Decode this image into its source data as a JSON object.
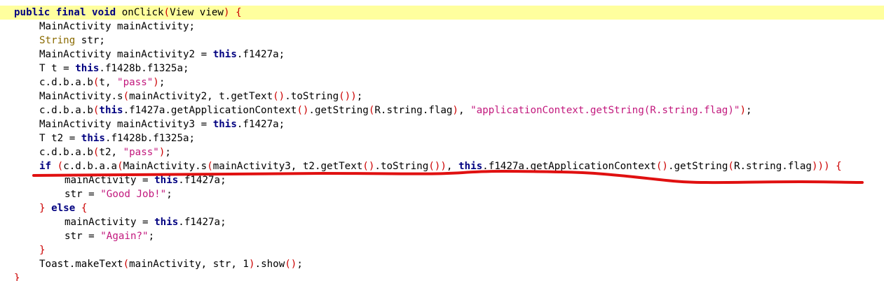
{
  "code_lines": [
    {
      "indent": 20,
      "highlighted": true,
      "tokens": [
        [
          "kw",
          "public final void "
        ],
        [
          "pl",
          "onClick"
        ],
        [
          "par",
          "("
        ],
        [
          "pl",
          "View view"
        ],
        [
          "par",
          ")"
        ],
        [
          "pl",
          " "
        ],
        [
          "par",
          "{"
        ]
      ]
    },
    {
      "indent": 56,
      "tokens": [
        [
          "pl",
          "MainActivity mainActivity;"
        ]
      ]
    },
    {
      "indent": 56,
      "tokens": [
        [
          "ty",
          "String"
        ],
        [
          "pl",
          " str;"
        ]
      ]
    },
    {
      "indent": 56,
      "tokens": [
        [
          "pl",
          "MainActivity mainActivity2 = "
        ],
        [
          "kw",
          "this"
        ],
        [
          "pl",
          ".f1427a;"
        ]
      ]
    },
    {
      "indent": 56,
      "tokens": [
        [
          "pl",
          "T t = "
        ],
        [
          "kw",
          "this"
        ],
        [
          "pl",
          ".f1428b.f1325a;"
        ]
      ]
    },
    {
      "indent": 56,
      "tokens": [
        [
          "pl",
          "c.d.b.a.b"
        ],
        [
          "par",
          "("
        ],
        [
          "pl",
          "t, "
        ],
        [
          "str",
          "\"pass\""
        ],
        [
          "par",
          ")"
        ],
        [
          "pl",
          ";"
        ]
      ]
    },
    {
      "indent": 56,
      "tokens": [
        [
          "pl",
          "MainActivity.s"
        ],
        [
          "par",
          "("
        ],
        [
          "pl",
          "mainActivity2, t.getText"
        ],
        [
          "par",
          "()"
        ],
        [
          "pl",
          ".toString"
        ],
        [
          "par",
          "())"
        ],
        [
          "pl",
          ";"
        ]
      ]
    },
    {
      "indent": 56,
      "tokens": [
        [
          "pl",
          "c.d.b.a.b"
        ],
        [
          "par",
          "("
        ],
        [
          "kw",
          "this"
        ],
        [
          "pl",
          ".f1427a.getApplicationContext"
        ],
        [
          "par",
          "()"
        ],
        [
          "pl",
          ".getString"
        ],
        [
          "par",
          "("
        ],
        [
          "pl",
          "R.string.flag"
        ],
        [
          "par",
          ")"
        ],
        [
          "pl",
          ", "
        ],
        [
          "str",
          "\"applicationContext.getString(R.string.flag)\""
        ],
        [
          "par",
          ")"
        ],
        [
          "pl",
          ";"
        ]
      ]
    },
    {
      "indent": 56,
      "tokens": [
        [
          "pl",
          "MainActivity mainActivity3 = "
        ],
        [
          "kw",
          "this"
        ],
        [
          "pl",
          ".f1427a;"
        ]
      ]
    },
    {
      "indent": 56,
      "tokens": [
        [
          "pl",
          "T t2 = "
        ],
        [
          "kw",
          "this"
        ],
        [
          "pl",
          ".f1428b.f1325a;"
        ]
      ]
    },
    {
      "indent": 56,
      "tokens": [
        [
          "pl",
          "c.d.b.a.b"
        ],
        [
          "par",
          "("
        ],
        [
          "pl",
          "t2, "
        ],
        [
          "str",
          "\"pass\""
        ],
        [
          "par",
          ")"
        ],
        [
          "pl",
          ";"
        ]
      ]
    },
    {
      "indent": 56,
      "tokens": [
        [
          "kw",
          "if"
        ],
        [
          "pl",
          " "
        ],
        [
          "par",
          "("
        ],
        [
          "pl",
          "c.d.b.a.a"
        ],
        [
          "par",
          "("
        ],
        [
          "pl",
          "MainActivity.s"
        ],
        [
          "par",
          "("
        ],
        [
          "pl",
          "mainActivity3, t2.getText"
        ],
        [
          "par",
          "()"
        ],
        [
          "pl",
          ".toString"
        ],
        [
          "par",
          "())"
        ],
        [
          "pl",
          ", "
        ],
        [
          "kw",
          "this"
        ],
        [
          "pl",
          ".f1427a.getApplicationContext"
        ],
        [
          "par",
          "()"
        ],
        [
          "pl",
          ".getString"
        ],
        [
          "par",
          "("
        ],
        [
          "pl",
          "R.string.flag"
        ],
        [
          "par",
          "))"
        ],
        [
          "par",
          ")"
        ],
        [
          "pl",
          " "
        ],
        [
          "par",
          "{"
        ]
      ]
    },
    {
      "indent": 92,
      "tokens": [
        [
          "pl",
          "mainActivity = "
        ],
        [
          "kw",
          "this"
        ],
        [
          "pl",
          ".f1427a;"
        ]
      ]
    },
    {
      "indent": 92,
      "tokens": [
        [
          "pl",
          "str = "
        ],
        [
          "str",
          "\"Good Job!\""
        ],
        [
          "pl",
          ";"
        ]
      ]
    },
    {
      "indent": 56,
      "tokens": [
        [
          "par",
          "}"
        ],
        [
          "pl",
          " "
        ],
        [
          "kw",
          "else"
        ],
        [
          "pl",
          " "
        ],
        [
          "par",
          "{"
        ]
      ]
    },
    {
      "indent": 92,
      "tokens": [
        [
          "pl",
          "mainActivity = "
        ],
        [
          "kw",
          "this"
        ],
        [
          "pl",
          ".f1427a;"
        ]
      ]
    },
    {
      "indent": 92,
      "tokens": [
        [
          "pl",
          "str = "
        ],
        [
          "str",
          "\"Again?\""
        ],
        [
          "pl",
          ";"
        ]
      ]
    },
    {
      "indent": 56,
      "tokens": [
        [
          "par",
          "}"
        ]
      ]
    },
    {
      "indent": 56,
      "tokens": [
        [
          "pl",
          "Toast.makeText"
        ],
        [
          "par",
          "("
        ],
        [
          "pl",
          "mainActivity, str, 1"
        ],
        [
          "par",
          ")"
        ],
        [
          "pl",
          ".show"
        ],
        [
          "par",
          "()"
        ],
        [
          "pl",
          ";"
        ]
      ]
    },
    {
      "indent": 20,
      "tokens": [
        [
          "par",
          "}"
        ]
      ]
    }
  ],
  "annotation": {
    "color": "#e01010"
  }
}
